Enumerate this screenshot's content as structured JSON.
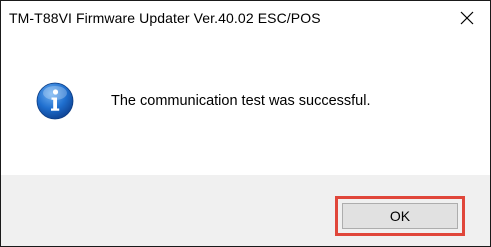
{
  "window": {
    "title": "TM-T88VI Firmware Updater Ver.40.02 ESC/POS"
  },
  "message": {
    "icon": "info-icon",
    "text": "The communication test was successful."
  },
  "buttons": {
    "ok_label": "OK"
  },
  "colors": {
    "highlight": "#e0463a",
    "footer_bg": "#f0f0f0",
    "info_icon": "#1c6dd0"
  }
}
